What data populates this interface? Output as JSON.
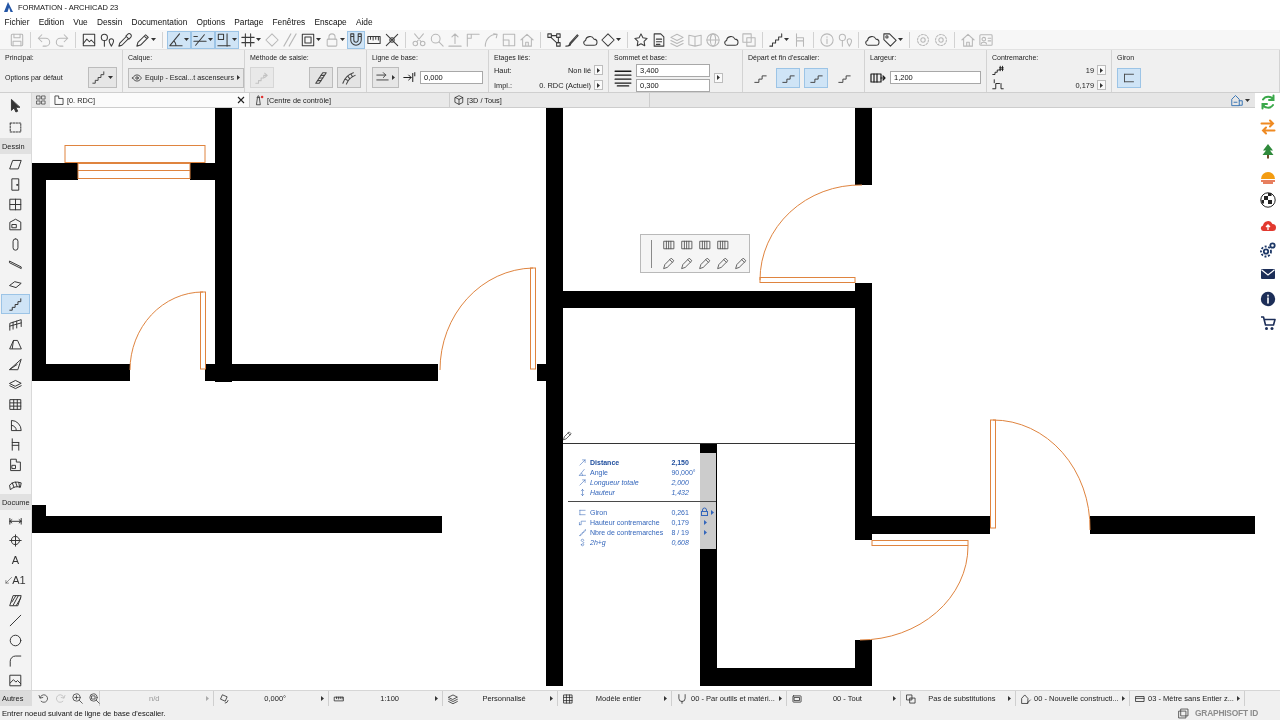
{
  "window": {
    "title": "FORMATION - ARCHICAD 23"
  },
  "menu": [
    "Fichier",
    "Edition",
    "Vue",
    "Dessin",
    "Documentation",
    "Options",
    "Partage",
    "Fenêtres",
    "Enscape",
    "Aide"
  ],
  "toolbar": [
    [
      {
        "kind": "floppy",
        "pressed": false,
        "disabled": true
      }
    ],
    [
      {
        "kind": "undo",
        "pressed": false,
        "disabled": true
      },
      {
        "kind": "redo",
        "pressed": false,
        "disabled": true
      }
    ],
    [
      {
        "kind": "frame",
        "pressed": false,
        "disabled": false
      },
      {
        "kind": "pin",
        "pressed": false,
        "disabled": false
      },
      {
        "kind": "eyedropper",
        "pressed": false,
        "disabled": false
      },
      {
        "kind": "pen",
        "pressed": false,
        "disabled": false,
        "caret": true
      }
    ],
    [
      {
        "kind": "angle",
        "pressed": true,
        "disabled": false,
        "caret": true
      },
      {
        "kind": "snapline",
        "pressed": true,
        "disabled": false,
        "caret": true
      },
      {
        "kind": "guide",
        "pressed": true,
        "disabled": false,
        "caret": true
      },
      {
        "kind": "grid",
        "pressed": false,
        "disabled": false,
        "caret": true
      },
      {
        "kind": "diamond",
        "pressed": false,
        "disabled": true
      },
      {
        "kind": "slash",
        "pressed": false,
        "disabled": true
      },
      {
        "kind": "square",
        "pressed": false,
        "disabled": false,
        "caret": true
      },
      {
        "kind": "lock",
        "pressed": false,
        "disabled": true,
        "caret": true
      },
      {
        "kind": "magnet",
        "pressed": true,
        "disabled": false
      },
      {
        "kind": "ruler",
        "pressed": false,
        "disabled": false
      },
      {
        "kind": "cross",
        "pressed": false,
        "disabled": false
      }
    ],
    [
      {
        "kind": "scissors",
        "pressed": false,
        "disabled": true
      },
      {
        "kind": "magnifier",
        "pressed": false,
        "disabled": true
      },
      {
        "kind": "arrowup",
        "pressed": false,
        "disabled": true
      },
      {
        "kind": "corner",
        "pressed": false,
        "disabled": true
      },
      {
        "kind": "curve",
        "pressed": false,
        "disabled": true
      },
      {
        "kind": "box",
        "pressed": false,
        "disabled": true
      },
      {
        "kind": "house",
        "pressed": false,
        "disabled": true
      }
    ],
    [
      {
        "kind": "nodes",
        "pressed": false,
        "disabled": false
      },
      {
        "kind": "brush",
        "pressed": false,
        "disabled": false
      },
      {
        "kind": "cloud",
        "pressed": false,
        "disabled": false
      },
      {
        "kind": "diamond",
        "pressed": false,
        "disabled": false,
        "caret": true
      }
    ],
    [
      {
        "kind": "star",
        "pressed": false,
        "disabled": false
      },
      {
        "kind": "document",
        "pressed": false,
        "disabled": false
      },
      {
        "kind": "stack",
        "pressed": false,
        "disabled": true
      },
      {
        "kind": "book",
        "pressed": false,
        "disabled": true
      },
      {
        "kind": "globe",
        "pressed": false,
        "disabled": true
      },
      {
        "kind": "cloud",
        "pressed": false,
        "disabled": false
      },
      {
        "kind": "copy",
        "pressed": false,
        "disabled": true
      }
    ],
    [
      {
        "kind": "stairs",
        "pressed": false,
        "disabled": false,
        "caret": true
      },
      {
        "kind": "chair",
        "pressed": false,
        "disabled": true
      }
    ],
    [
      {
        "kind": "info",
        "pressed": false,
        "disabled": true
      },
      {
        "kind": "pin",
        "pressed": false,
        "disabled": true
      }
    ],
    [
      {
        "kind": "cloud",
        "pressed": false,
        "disabled": false
      },
      {
        "kind": "tag",
        "pressed": false,
        "disabled": false,
        "caret": true
      }
    ],
    [
      {
        "kind": "gears",
        "pressed": false,
        "disabled": true
      },
      {
        "kind": "gears",
        "pressed": false,
        "disabled": true
      }
    ],
    [
      {
        "kind": "house",
        "pressed": false,
        "disabled": true
      },
      {
        "kind": "card",
        "pressed": false,
        "disabled": true
      }
    ]
  ],
  "info_box": {
    "main": {
      "label": "Principal:",
      "value": "Options par défaut"
    },
    "layer": {
      "label": "Calque:",
      "value": "Equip - Escal...t ascenseurs"
    },
    "input_method": {
      "label": "Méthode de saisie:",
      "buttons": [
        {
          "kind": "segment",
          "disabled": true
        },
        {
          "kind": "straight",
          "disabled": false
        },
        {
          "kind": "curved",
          "disabled": false
        }
      ]
    },
    "baseline": {
      "label": "Ligne de base:",
      "value": "0,000"
    },
    "linked_stories": {
      "label": "Etages liés:",
      "rows": [
        {
          "label": "Haut:",
          "value": "Non lié"
        },
        {
          "label": "Impl.:",
          "value": "0. RDC (Actuel)"
        }
      ]
    },
    "top_and_bottom": {
      "label": "Sommet et base:",
      "values": [
        "3,400",
        "0,300"
      ]
    },
    "stair_ends": {
      "label": "Départ et fin d'escalier:",
      "buttons": [
        {
          "selected": false
        },
        {
          "selected": true
        },
        {
          "selected": true
        },
        {
          "selected": false
        }
      ]
    },
    "width": {
      "label": "Largeur:",
      "value": "1,200"
    },
    "riser": {
      "label": "Contremarche:",
      "rows": [
        {
          "kind": "risercount",
          "value": "19"
        },
        {
          "kind": "riserheight",
          "value": "0,179"
        }
      ]
    },
    "tread": {
      "label": "Giron",
      "buttons": [
        {
          "selected": true
        }
      ]
    }
  },
  "tabs": [
    {
      "kind": "plan",
      "label": "[0. RDC]",
      "selected": true,
      "closable": true
    },
    {
      "kind": "center",
      "label": "[Centre de contrôle]",
      "selected": false,
      "closable": false
    },
    {
      "kind": "model",
      "label": "[3D / Tous]",
      "selected": false,
      "closable": false
    }
  ],
  "toolbox": {
    "top": [
      {
        "kind": "pointer",
        "selected": false
      },
      {
        "kind": "marquee",
        "selected": false
      }
    ],
    "sections": [
      {
        "title": "Dessin",
        "tools": [
          {
            "kind": "wall",
            "selected": false
          },
          {
            "kind": "door",
            "selected": false
          },
          {
            "kind": "window",
            "selected": false
          },
          {
            "kind": "skylight",
            "selected": false
          },
          {
            "kind": "column",
            "selected": false
          },
          {
            "kind": "beam",
            "selected": false
          },
          {
            "kind": "slab",
            "selected": false
          },
          {
            "kind": "stairs",
            "selected": true
          },
          {
            "kind": "railing",
            "selected": false
          },
          {
            "kind": "roof",
            "selected": false
          },
          {
            "kind": "shell",
            "selected": false
          },
          {
            "kind": "morph",
            "selected": false
          },
          {
            "kind": "curtainwall",
            "selected": false
          },
          {
            "kind": "fan",
            "selected": false
          },
          {
            "kind": "chair",
            "selected": false
          },
          {
            "kind": "zone",
            "selected": false
          },
          {
            "kind": "terrain",
            "selected": false
          }
        ]
      },
      {
        "title": "Docume",
        "tools": [
          {
            "kind": "dimension",
            "selected": false
          },
          {
            "kind": "level",
            "selected": false
          },
          {
            "kind": "text",
            "glyph": "A",
            "selected": false
          },
          {
            "kind": "label",
            "glyph": "A1",
            "selected": false
          },
          {
            "kind": "fill",
            "selected": false
          },
          {
            "kind": "line",
            "selected": false
          },
          {
            "kind": "circle",
            "selected": false
          },
          {
            "kind": "polyline",
            "selected": false
          },
          {
            "kind": "drawing",
            "selected": false
          }
        ]
      }
    ],
    "footer": "Autres"
  },
  "tracker": {
    "groups": [
      [
        {
          "kind": "distance",
          "label": "Distance",
          "value": "2,150",
          "locked": false,
          "arrow": false
        },
        {
          "kind": "angle",
          "label": "Angle",
          "value": "90,000°",
          "locked": false,
          "arrow": false
        },
        {
          "kind": "length",
          "label": "Longueur totale",
          "value": "2,000",
          "locked": false,
          "arrow": false
        },
        {
          "kind": "height",
          "label": "Hauteur",
          "value": "1,432",
          "locked": false,
          "arrow": false
        }
      ],
      [
        {
          "kind": "tread",
          "label": "Giron",
          "value": "0,261",
          "locked": true,
          "arrow": true
        },
        {
          "kind": "riser",
          "label": "Hauteur contremarche",
          "value": "0,179",
          "locked": false,
          "arrow": true
        },
        {
          "kind": "count",
          "label": "Nbre de contremarches",
          "value": "8 / 19",
          "locked": false,
          "arrow": true
        },
        {
          "kind": "formula",
          "label": "2h+g",
          "value": "0,608",
          "locked": false,
          "arrow": false
        }
      ]
    ]
  },
  "navigation": [
    {
      "kind": "back",
      "disabled": false
    },
    {
      "kind": "forward",
      "disabled": true
    },
    {
      "kind": "zoomin",
      "disabled": false
    },
    {
      "kind": "zoomfit",
      "disabled": false
    }
  ],
  "view_settings": [
    {
      "kind": "plain",
      "value": "n/d",
      "disabled": true
    },
    {
      "kind": "rotate",
      "value": "0,000°",
      "disabled": false
    },
    {
      "kind": "scale",
      "value": "1:100",
      "disabled": false
    },
    {
      "kind": "layers",
      "value": "Personnalisé",
      "disabled": false
    },
    {
      "kind": "model",
      "value": "Modèle entier",
      "disabled": false
    },
    {
      "kind": "pentool",
      "value": "00 - Par outils et matéri...",
      "disabled": false
    },
    {
      "kind": "display",
      "value": "00 - Tout",
      "disabled": false
    },
    {
      "kind": "override",
      "value": "Pas de substitutions",
      "disabled": false
    },
    {
      "kind": "phase",
      "value": "00 - Nouvelle constructi...",
      "disabled": false
    },
    {
      "kind": "dimstyle",
      "value": "03 - Mètre sans Entier z...",
      "disabled": false
    }
  ],
  "status_bar": {
    "message": "Entrer noeud suivant de ligne de base d'escalier.",
    "account": {
      "label": "GRAPHISOFT ID",
      "disabled": true
    }
  }
}
